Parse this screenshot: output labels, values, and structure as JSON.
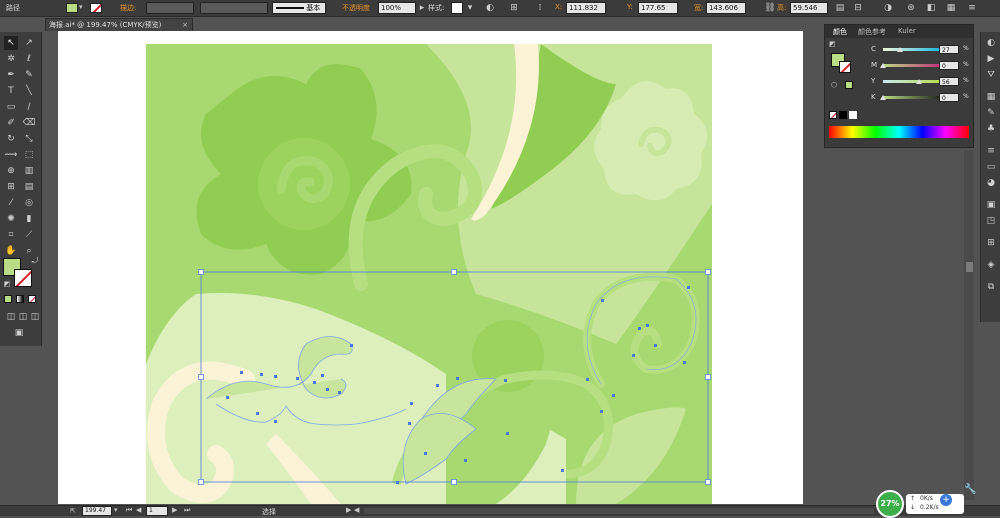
{
  "control_bar": {
    "selection_label": "路径",
    "stroke_label": "描边:",
    "brush_profile": "基本",
    "opacity_label": "不透明度",
    "opacity_value": "100%",
    "style_label": "样式:",
    "x_label": "X:",
    "x_value": "111.832",
    "y_label": "Y:",
    "y_value": "177.65",
    "w_label": "宽:",
    "w_value": "143.606",
    "h_label": "高:",
    "h_value": "59.546"
  },
  "document_tab": {
    "title": "海报.ai* @ 199.47% (CMYK/预览)",
    "close_glyph": "×"
  },
  "color_panel": {
    "tabs": [
      "颜色",
      "颜色参考",
      "Kuler"
    ],
    "sliders": [
      {
        "name": "C",
        "value": "27",
        "unit": "%"
      },
      {
        "name": "M",
        "value": "0",
        "unit": "%"
      },
      {
        "name": "Y",
        "value": "56",
        "unit": "%"
      },
      {
        "name": "K",
        "value": "0",
        "unit": "%"
      }
    ],
    "fill_swatch_color": "#b9dc84",
    "slider_positions": [
      0.27,
      0.0,
      0.56,
      0.0
    ]
  },
  "status_bar": {
    "zoom_value": "199.47",
    "artboard_number": "1",
    "tool_status": "选择"
  },
  "network_widget": {
    "percent": "27%",
    "up_rate": "0K/s",
    "down_rate": "0.2K/s"
  },
  "colors": {
    "bg_green": "#a8d870",
    "dark_green": "#8fcb4f",
    "light_green": "#c8e79e",
    "cream": "#fbf3d6",
    "selection_blue": "#4b7be0"
  }
}
